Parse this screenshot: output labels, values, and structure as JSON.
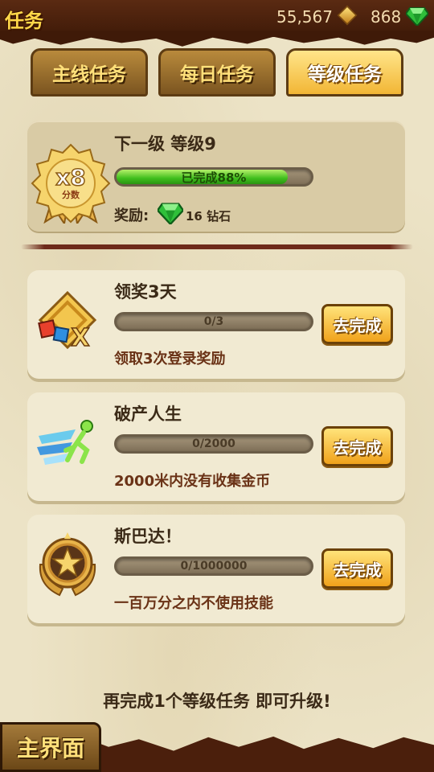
{
  "header": {
    "title": "任务",
    "gold": "55,567",
    "gems": "868"
  },
  "tabs": [
    {
      "label": "主线任务",
      "active": false
    },
    {
      "label": "每日任务",
      "active": false
    },
    {
      "label": "等级任务",
      "active": true
    }
  ],
  "level": {
    "title": "下一级 等级9",
    "badge_multiplier": "x8",
    "badge_label": "分数",
    "progress_text": "已完成88%",
    "progress": 0.88,
    "reward_label": "奖励:",
    "reward_text": "16 钻石"
  },
  "tasks": [
    {
      "title": "领奖3天",
      "progress_text": "0/3",
      "progress": 0,
      "description": "领取3次登录奖励",
      "button": "去完成",
      "icon": "login-reward-icon"
    },
    {
      "title": "破产人生",
      "progress_text": "0/2000",
      "progress": 0,
      "description": "2000米内没有收集金币",
      "button": "去完成",
      "icon": "running-man-icon"
    },
    {
      "title": "斯巴达！",
      "progress_text": "0/1000000",
      "progress": 0,
      "description": "一百万分之内不使用技能",
      "button": "去完成",
      "icon": "star-medal-icon"
    }
  ],
  "footer": {
    "tip": "再完成1个等级任务 即可升级!",
    "main_button": "主界面"
  },
  "colors": {
    "header_bg": "#4a1f0b",
    "tab_active": "#f2b635",
    "progress_green": "#3fbe1d",
    "button_orange": "#f0a21b"
  }
}
